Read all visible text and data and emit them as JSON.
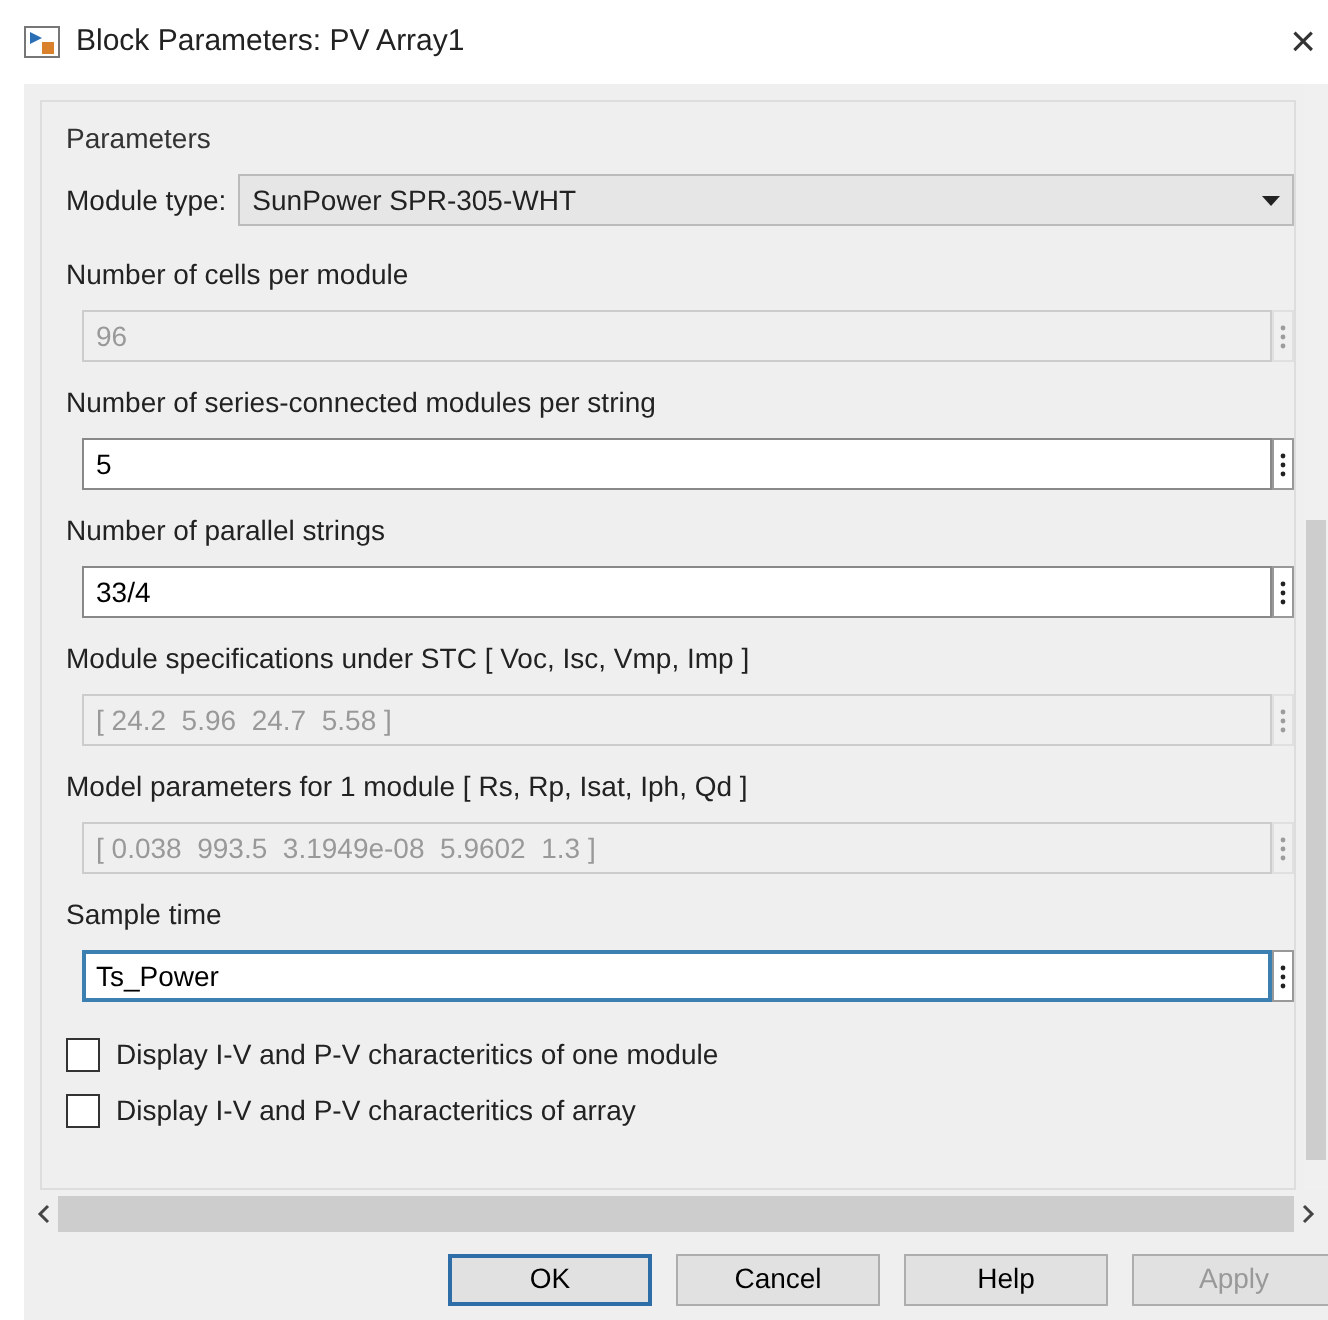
{
  "window": {
    "title": "Block Parameters: PV Array1",
    "close": "×"
  },
  "parameters": {
    "legend": "Parameters",
    "module_type": {
      "label": "Module type:",
      "value": "SunPower SPR-305-WHT"
    },
    "fields": [
      {
        "label": "Number of cells per module",
        "value": "96",
        "disabled": true,
        "focused": false
      },
      {
        "label": "Number of series-connected  modules per string",
        "value": "5",
        "disabled": false,
        "focused": false
      },
      {
        "label": "Number of parallel strings",
        "value": "33/4",
        "disabled": false,
        "focused": false
      },
      {
        "label": "Module specifications under STC  [  Voc, Isc, Vmp, Imp ]",
        "value": "[ 24.2  5.96  24.7  5.58 ]",
        "disabled": true,
        "focused": false
      },
      {
        "label": "Model parameters for 1 module [ Rs, Rp, Isat, Iph, Qd ]",
        "value": "[ 0.038  993.5  3.1949e-08  5.9602  1.3 ]",
        "disabled": true,
        "focused": false
      },
      {
        "label": "Sample time",
        "value": "Ts_Power",
        "disabled": false,
        "focused": true
      }
    ],
    "checkboxes": [
      {
        "label": "Display  I-V and  P-V characteritics of one module",
        "checked": false
      },
      {
        "label": "Display  I-V and  P-V characteritics of array",
        "checked": false
      }
    ]
  },
  "buttons": [
    {
      "label": "OK",
      "default": true,
      "disabled": false
    },
    {
      "label": "Cancel",
      "default": false,
      "disabled": false
    },
    {
      "label": "Help",
      "default": false,
      "disabled": false
    },
    {
      "label": "Apply",
      "default": false,
      "disabled": true
    }
  ]
}
